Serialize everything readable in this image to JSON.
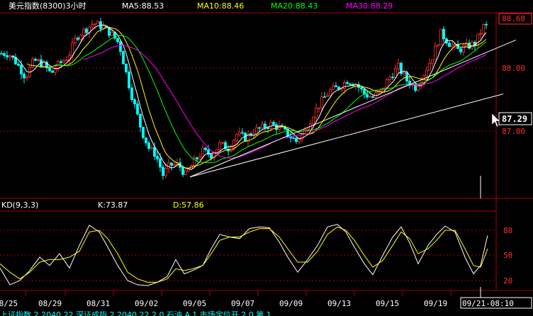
{
  "header": {
    "title": "美元指数(8300)3小时",
    "indicators": [
      {
        "label": "MA5:88.53",
        "color": "#ffffff"
      },
      {
        "label": "MA10:88.46",
        "color": "#ffff00"
      },
      {
        "label": "MA20:88.43",
        "color": "#00ff00"
      },
      {
        "label": "MA30:88.29",
        "color": "#ff00ff"
      }
    ]
  },
  "kd_header": {
    "name": "KD(9,3,3)",
    "k_label": "K:73.87",
    "d_label": "D:57.86"
  },
  "cursor_price": "87.29",
  "footer": {
    "current_time": "09/21-08:10",
    "ticker_fragment": "上证指数 2 2040 22   深证成指 2 2040 22   2 0 石油   A.1 市场定位开 2 0 第 1"
  },
  "colors": {
    "background": "#000000",
    "up_candle": "#ff3030",
    "down_candle": "#00ffff",
    "grid": "#b00000",
    "axis_text": "#ff3030",
    "ma5": "#ffffff",
    "ma10": "#ffff00",
    "ma20": "#00ff00",
    "ma30": "#ff00ff",
    "k_line": "#ffffff",
    "d_line": "#ffff00"
  },
  "chart_data": [
    {
      "type": "candlestick",
      "title": "美元指数(8300)3小时",
      "x_tick_labels": [
        "08/25",
        "08/29",
        "08/31",
        "09/02",
        "09/05",
        "09/07",
        "09/09",
        "09/13",
        "09/15",
        "09/19",
        "09/21-08:10"
      ],
      "y_tick_labels": [
        "88.68",
        "88.00",
        "87.00"
      ],
      "y_tick_values": [
        88.68,
        88.0,
        87.0
      ],
      "ylim": [
        86.2,
        88.75
      ],
      "grid": true,
      "highlighted_price": 87.29,
      "moving_averages": {
        "MA5": 88.53,
        "MA10": 88.46,
        "MA20": 88.43,
        "MA30": 88.29
      },
      "price_path": [
        [
          0,
          88.15
        ],
        [
          12,
          88.15
        ],
        [
          24,
          88.0
        ],
        [
          36,
          87.8
        ],
        [
          48,
          88.05
        ],
        [
          60,
          88.0
        ],
        [
          72,
          87.85
        ],
        [
          84,
          88.0
        ],
        [
          96,
          88.1
        ],
        [
          108,
          88.4
        ],
        [
          120,
          88.5
        ],
        [
          132,
          88.6
        ],
        [
          144,
          88.55
        ],
        [
          156,
          88.45
        ],
        [
          168,
          88.3
        ],
        [
          176,
          87.95
        ],
        [
          184,
          87.6
        ],
        [
          192,
          87.3
        ],
        [
          200,
          87.0
        ],
        [
          210,
          86.75
        ],
        [
          220,
          86.65
        ],
        [
          230,
          86.35
        ],
        [
          240,
          86.5
        ],
        [
          252,
          86.5
        ],
        [
          262,
          86.35
        ],
        [
          274,
          86.55
        ],
        [
          286,
          86.7
        ],
        [
          298,
          86.65
        ],
        [
          310,
          86.8
        ],
        [
          322,
          86.75
        ],
        [
          334,
          86.95
        ],
        [
          346,
          86.9
        ],
        [
          358,
          87.0
        ],
        [
          370,
          87.05
        ],
        [
          382,
          87.1
        ],
        [
          394,
          87.05
        ],
        [
          406,
          86.95
        ],
        [
          418,
          86.85
        ],
        [
          430,
          87.0
        ],
        [
          442,
          87.25
        ],
        [
          454,
          87.45
        ],
        [
          466,
          87.6
        ],
        [
          478,
          87.65
        ],
        [
          490,
          87.75
        ],
        [
          502,
          87.7
        ],
        [
          514,
          87.55
        ],
        [
          526,
          87.5
        ],
        [
          538,
          87.6
        ],
        [
          550,
          87.8
        ],
        [
          562,
          87.95
        ],
        [
          574,
          87.75
        ],
        [
          586,
          87.65
        ],
        [
          598,
          87.85
        ],
        [
          610,
          88.1
        ],
        [
          622,
          88.45
        ],
        [
          634,
          88.3
        ],
        [
          646,
          88.2
        ],
        [
          658,
          88.25
        ],
        [
          670,
          88.3
        ],
        [
          682,
          88.55
        ]
      ],
      "trendlines": [
        {
          "from": [
            268,
            86.32
          ],
          "to": [
            728,
            88.35
          ]
        },
        {
          "from": [
            268,
            86.32
          ],
          "to": [
            710,
            87.55
          ]
        }
      ]
    },
    {
      "type": "line",
      "title": "KD(9,3,3)",
      "y_tick_labels": [
        "80",
        "50",
        "20"
      ],
      "y_tick_values": [
        80,
        50,
        20
      ],
      "ylim": [
        5,
        95
      ],
      "grid": true,
      "series": [
        {
          "name": "K",
          "color": "#ffffff",
          "latest": 73.87,
          "values": [
            [
              0,
              35
            ],
            [
              14,
              15
            ],
            [
              28,
              20
            ],
            [
              42,
              32
            ],
            [
              56,
              48
            ],
            [
              70,
              38
            ],
            [
              84,
              52
            ],
            [
              98,
              35
            ],
            [
              112,
              62
            ],
            [
              126,
              86
            ],
            [
              140,
              78
            ],
            [
              152,
              60
            ],
            [
              166,
              38
            ],
            [
              180,
              20
            ],
            [
              194,
              15
            ],
            [
              208,
              14
            ],
            [
              222,
              18
            ],
            [
              236,
              25
            ],
            [
              248,
              45
            ],
            [
              260,
              28
            ],
            [
              272,
              32
            ],
            [
              286,
              38
            ],
            [
              298,
              58
            ],
            [
              310,
              75
            ],
            [
              324,
              72
            ],
            [
              338,
              70
            ],
            [
              352,
              82
            ],
            [
              366,
              84
            ],
            [
              380,
              83
            ],
            [
              394,
              66
            ],
            [
              406,
              48
            ],
            [
              420,
              30
            ],
            [
              434,
              45
            ],
            [
              448,
              62
            ],
            [
              462,
              84
            ],
            [
              476,
              87
            ],
            [
              488,
              78
            ],
            [
              500,
              60
            ],
            [
              514,
              40
            ],
            [
              526,
              27
            ],
            [
              540,
              50
            ],
            [
              554,
              72
            ],
            [
              566,
              84
            ],
            [
              578,
              65
            ],
            [
              590,
              40
            ],
            [
              604,
              62
            ],
            [
              616,
              75
            ],
            [
              628,
              85
            ],
            [
              642,
              78
            ],
            [
              656,
              48
            ],
            [
              668,
              28
            ],
            [
              678,
              38
            ],
            [
              688,
              73.87
            ]
          ]
        },
        {
          "name": "D",
          "color": "#ffff00",
          "latest": 57.86,
          "values": [
            [
              0,
              40
            ],
            [
              14,
              30
            ],
            [
              28,
              22
            ],
            [
              42,
              30
            ],
            [
              56,
              42
            ],
            [
              70,
              45
            ],
            [
              84,
              45
            ],
            [
              98,
              48
            ],
            [
              112,
              55
            ],
            [
              126,
              78
            ],
            [
              140,
              80
            ],
            [
              152,
              70
            ],
            [
              166,
              52
            ],
            [
              180,
              30
            ],
            [
              194,
              22
            ],
            [
              208,
              18
            ],
            [
              222,
              18
            ],
            [
              236,
              22
            ],
            [
              248,
              34
            ],
            [
              260,
              32
            ],
            [
              272,
              34
            ],
            [
              286,
              38
            ],
            [
              298,
              52
            ],
            [
              310,
              68
            ],
            [
              324,
              72
            ],
            [
              338,
              72
            ],
            [
              352,
              78
            ],
            [
              366,
              82
            ],
            [
              380,
              82
            ],
            [
              394,
              72
            ],
            [
              406,
              58
            ],
            [
              420,
              42
            ],
            [
              434,
              42
            ],
            [
              448,
              55
            ],
            [
              462,
              75
            ],
            [
              476,
              84
            ],
            [
              488,
              80
            ],
            [
              500,
              68
            ],
            [
              514,
              50
            ],
            [
              526,
              36
            ],
            [
              540,
              44
            ],
            [
              554,
              62
            ],
            [
              566,
              78
            ],
            [
              578,
              70
            ],
            [
              590,
              52
            ],
            [
              604,
              58
            ],
            [
              616,
              68
            ],
            [
              628,
              80
            ],
            [
              642,
              80
            ],
            [
              656,
              58
            ],
            [
              668,
              38
            ],
            [
              678,
              36
            ],
            [
              688,
              57.86
            ]
          ]
        }
      ]
    }
  ]
}
